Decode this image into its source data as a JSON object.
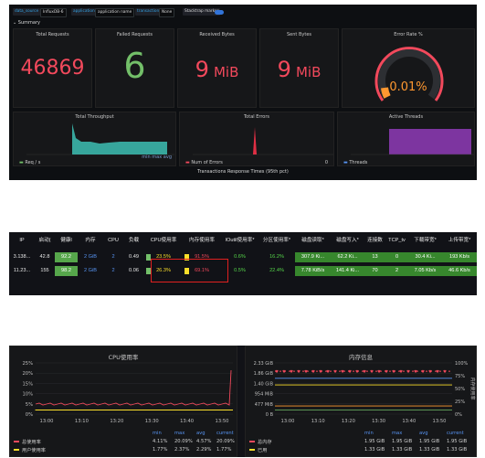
{
  "colors": {
    "red": "#f2495c",
    "green": "#73bf69",
    "yellow": "#fade2a",
    "orange": "#ff9830",
    "teal": "#3dc0b4",
    "purple": "#8f3bb8",
    "blue": "#5794f2"
  },
  "dashboard": {
    "toolbar": {
      "items": [
        {
          "label": "data_source",
          "kind": "var"
        },
        {
          "label": "InfluxDB-6",
          "kind": "value"
        },
        {
          "label": "application",
          "kind": "var"
        },
        {
          "label": "application name",
          "kind": "value"
        },
        {
          "label": "transaction",
          "kind": "var"
        },
        {
          "label": "None",
          "kind": "value"
        },
        {
          "label": "Stacktrap marker",
          "kind": "var"
        }
      ]
    },
    "row_title": "Summary",
    "stats": [
      {
        "title": "Total Requests",
        "value": "46869",
        "color": "#f2495c"
      },
      {
        "title": "Failed Requests",
        "value": "6",
        "color": "#73bf69"
      },
      {
        "title": "Received Bytes",
        "value": "9",
        "unit": "MiB",
        "color": "#f2495c"
      },
      {
        "title": "Sent Bytes",
        "value": "9",
        "unit": "MiB",
        "color": "#f2495c"
      },
      {
        "title": "Error Rate %",
        "value": "0.01%",
        "color": "#ff9830",
        "gauge_fraction": 0.0001
      }
    ],
    "mini_charts": [
      {
        "title": "Total Throughput",
        "legend": "Req / s",
        "legend_vals": [
          "min",
          "max",
          "avg"
        ]
      },
      {
        "title": "Total Errors",
        "legend": "Num of Errors",
        "legend_vals": [
          "0"
        ]
      },
      {
        "title": "Active Threads",
        "legend": "Threads",
        "legend_vals": []
      }
    ],
    "bottom_title": "Transactions Response Times (95th pct)"
  },
  "host_table": {
    "headers": [
      "IP",
      "启动(",
      "健康l",
      "内存",
      "CPU",
      "负载",
      "CPU使用率",
      "内存使用率",
      "IOutil使用率*",
      "分区使用率*",
      "磁盘读取*",
      "磁盘写入*",
      "连接数",
      "TCP_tv",
      "下载带宽*",
      "上传带宽*"
    ],
    "rows": [
      [
        "3.138...",
        "42.8",
        "92.2",
        "2 GiB",
        "2",
        "0.49",
        "23.5%",
        "91.5%",
        "0.6%",
        "16.2%",
        "307.9 Ki...",
        "62.2 Ki...",
        "13",
        "0",
        "30.4 Ki...",
        "193 Kb/s"
      ],
      [
        "11.23...",
        "155",
        "98.2",
        "2 GiB",
        "2",
        "0.06",
        "26.3%",
        "69.1%",
        "0.5%",
        "22.4%",
        "7.78 KiB/s",
        "141.4 Ki...",
        "70",
        "2",
        "7.05 Kb/s",
        "46.6 Kb/s"
      ]
    ]
  },
  "cpu_panel": {
    "title": "CPU使用率",
    "y_ticks": [
      "25%",
      "20%",
      "15%",
      "10%",
      "5%",
      "0%"
    ],
    "x_ticks": [
      "13:00",
      "13:10",
      "13:20",
      "13:30",
      "13:40",
      "13:50"
    ],
    "legend_headers": [
      "min",
      "max",
      "avg",
      "current"
    ],
    "legend_rows": [
      {
        "name": "总使用率",
        "color": "#f2495c",
        "vals": [
          "4.11%",
          "20.09%",
          "4.57%",
          "20.09%"
        ]
      },
      {
        "name": "用户使用率",
        "color": "#fade2a",
        "vals": [
          "1.77%",
          "2.37%",
          "2.29%",
          "1.77%"
        ]
      }
    ]
  },
  "mem_panel": {
    "title": "内存信息",
    "y_ticks_left": [
      "2.33 GiB",
      "1.86 GiB",
      "1.40 GiB",
      "954 MiB",
      "477 MiB",
      "0 B"
    ],
    "y_ticks_right": [
      "100%",
      "75%",
      "50%",
      "25%",
      "0%"
    ],
    "x_ticks": [
      "13:00",
      "13:10",
      "13:20",
      "13:30",
      "13:40",
      "13:50"
    ],
    "right_axis_label": "内存使用率",
    "legend_headers": [
      "min",
      "max",
      "avg",
      "current"
    ],
    "legend_rows": [
      {
        "name": "总内存",
        "color": "#f2495c",
        "vals": [
          "1.95 GiB",
          "1.95 GiB",
          "1.95 GiB",
          "1.95 GiB"
        ]
      },
      {
        "name": "已用",
        "color": "#fade2a",
        "vals": [
          "1.33 GiB",
          "1.33 GiB",
          "1.33 GiB",
          "1.33 GiB"
        ]
      }
    ]
  }
}
